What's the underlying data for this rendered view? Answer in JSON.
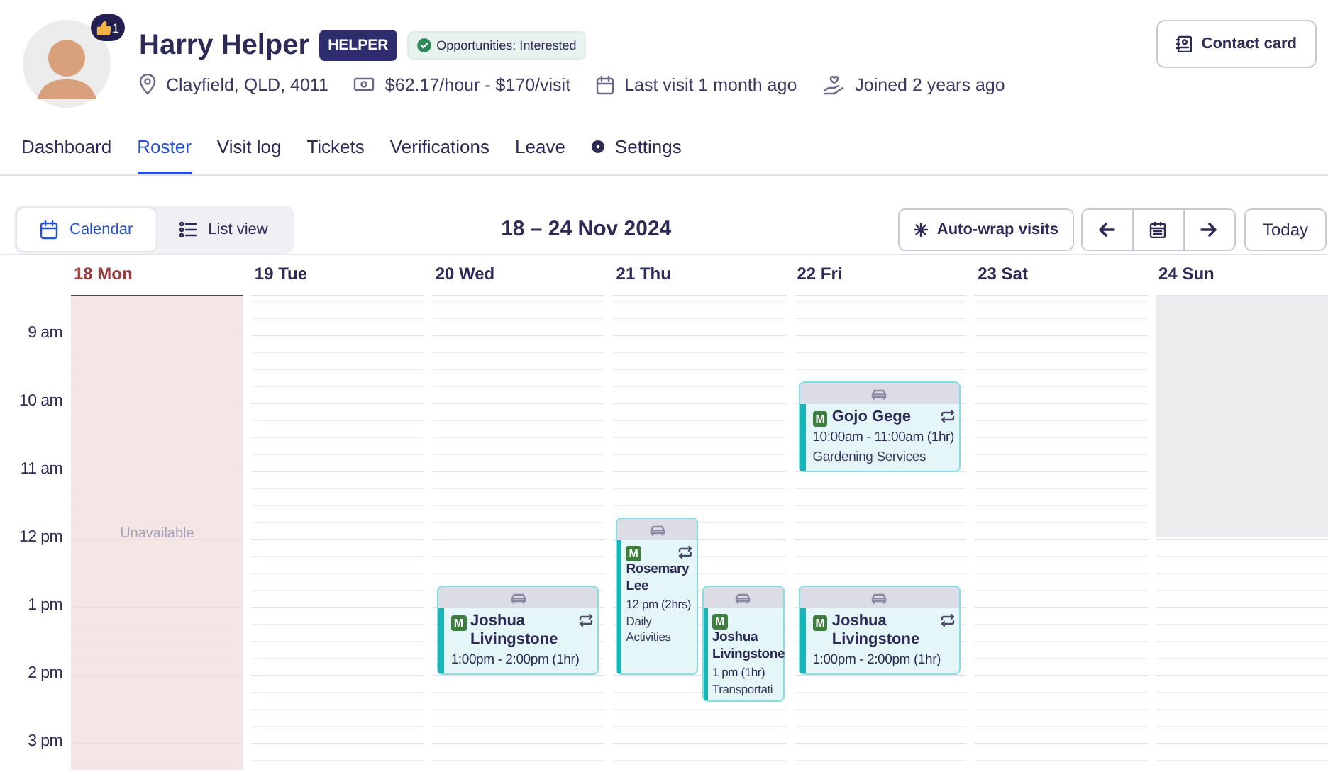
{
  "profile": {
    "name": "Harry Helper",
    "role_badge": "HELPER",
    "status": "Opportunities: Interested",
    "likes": "1",
    "meta": [
      {
        "kind": "location",
        "text": "Clayfield, QLD, 4011"
      },
      {
        "kind": "money",
        "text": "$62.17/hour - $170/visit"
      },
      {
        "kind": "calendar",
        "text": "Last visit 1 month ago"
      },
      {
        "kind": "joined",
        "text": "Joined 2 years ago"
      }
    ],
    "contact_button": "Contact card"
  },
  "tabs": [
    {
      "kind": "plain",
      "label": "Dashboard",
      "selected": false
    },
    {
      "kind": "plain",
      "label": "Roster",
      "selected": true
    },
    {
      "kind": "plain",
      "label": "Visit log",
      "selected": false
    },
    {
      "kind": "plain",
      "label": "Tickets",
      "selected": false
    },
    {
      "kind": "plain",
      "label": "Verifications",
      "selected": false
    },
    {
      "kind": "plain",
      "label": "Leave",
      "selected": false
    },
    {
      "kind": "settings",
      "label": "Settings",
      "selected": false
    }
  ],
  "toolbar": {
    "views": [
      {
        "label": "Calendar",
        "selected": true
      },
      {
        "label": "List view",
        "selected": false
      }
    ],
    "date_range": "18 – 24 Nov 2024",
    "auto_wrap_button": "Auto-wrap visits",
    "today_button": "Today"
  },
  "calendar": {
    "hours": [
      "9 am",
      "10 am",
      "11 am",
      "12 pm",
      "1 pm",
      "2 pm",
      "3 pm"
    ],
    "days": [
      {
        "label": "18 Mon",
        "today": true,
        "unavailable": {
          "kind": "all-day",
          "label": "Unavailable"
        }
      },
      {
        "label": "19 Tue",
        "today": false
      },
      {
        "label": "20 Wed",
        "today": false,
        "events": [
          {
            "badge": "M",
            "title": "Joshua Livingstone",
            "time": "1:00pm - 2:00pm (1hr)",
            "recurring": true
          }
        ]
      },
      {
        "label": "21 Thu",
        "today": false,
        "events": [
          {
            "badge": "M",
            "title": "Rosemary Lee",
            "time": "12 pm (2hrs)",
            "service": "Daily Activities",
            "recurring": true
          },
          {
            "badge": "M",
            "title": "Joshua Livingstone",
            "time": "1 pm (1hr)",
            "service": "Transportati",
            "recurring": false
          }
        ]
      },
      {
        "label": "22 Fri",
        "today": false,
        "events": [
          {
            "badge": "M",
            "title": "Gojo Gege",
            "time": "10:00am - 11:00am (1hr)",
            "service": "Gardening Services",
            "recurring": true
          },
          {
            "badge": "M",
            "title": "Joshua Livingstone",
            "time": "1:00pm - 2:00pm (1hr)",
            "recurring": true
          }
        ]
      },
      {
        "label": "23 Sat",
        "today": false
      },
      {
        "label": "24 Sun",
        "today": false,
        "unavailable": {
          "kind": "morning"
        }
      }
    ]
  }
}
